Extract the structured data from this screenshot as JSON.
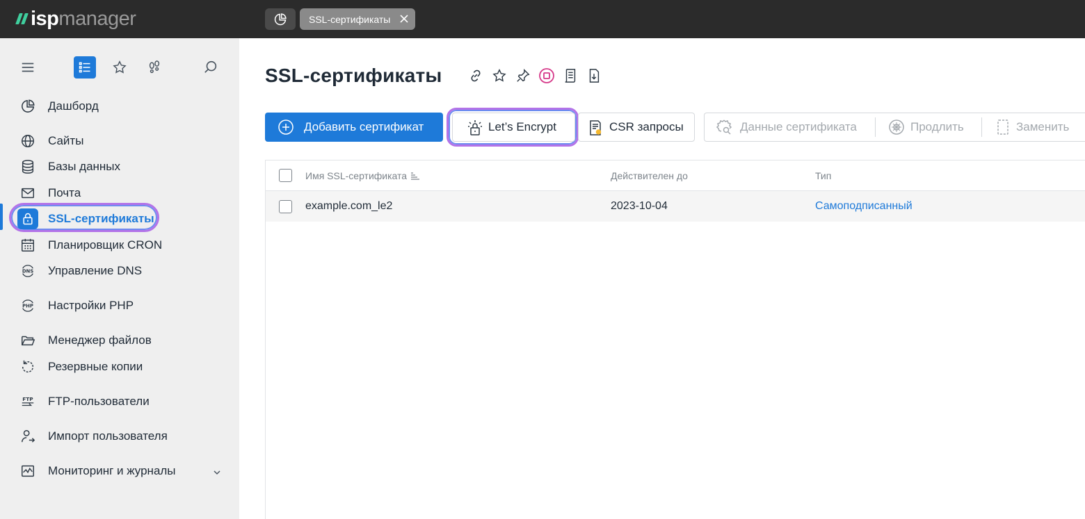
{
  "app": {
    "logo_isp": "isp",
    "logo_manager": "manager"
  },
  "tabs": [
    {
      "icon": "dashboard-pie-icon"
    },
    {
      "label": "SSL-сертификаты",
      "icon": "close-icon"
    }
  ],
  "sidebar": {
    "tools": [
      "menu-icon",
      "list-icon",
      "star-icon",
      "footprints-icon",
      "search-icon"
    ],
    "items": [
      {
        "label": "Дашборд",
        "icon": "dashboard-pie-icon"
      },
      {
        "label": "Сайты",
        "icon": "globe-icon"
      },
      {
        "label": "Базы данных",
        "icon": "database-icon"
      },
      {
        "label": "Почта",
        "icon": "mail-icon"
      },
      {
        "label": "SSL-сертификаты",
        "icon": "lock-icon",
        "active": true
      },
      {
        "label": "Планировщик CRON",
        "icon": "calendar-icon"
      },
      {
        "label": "Управление DNS",
        "icon": "dns-icon"
      },
      {
        "label": "Настройки PHP",
        "icon": "php-icon"
      },
      {
        "label": "Менеджер файлов",
        "icon": "folder-icon"
      },
      {
        "label": "Резервные копии",
        "icon": "backup-icon"
      },
      {
        "label": "FTP-пользователи",
        "icon": "ftp-icon"
      },
      {
        "label": "Импорт пользователя",
        "icon": "user-import-icon"
      },
      {
        "label": "Мониторинг и журналы",
        "icon": "monitoring-icon"
      }
    ]
  },
  "page": {
    "title": "SSL-сертификаты",
    "title_icons": [
      "link-icon",
      "star-icon",
      "pin-icon",
      "stop-icon",
      "log-icon",
      "download-icon"
    ]
  },
  "toolbar": {
    "add": "Добавить сертификат",
    "letsencrypt": "Let’s Encrypt",
    "csr": "CSR запросы",
    "details": "Данные сертификата",
    "renew": "Продлить",
    "replace": "Заменить"
  },
  "table": {
    "columns": [
      "Имя SSL-сертификата",
      "Действителен до",
      "Тип"
    ],
    "rows": [
      {
        "name": "example.com_le2",
        "valid_until": "2023-10-04",
        "type": "Самоподписанный"
      }
    ]
  },
  "colors": {
    "accent": "#1e7ad9",
    "highlight": "#b373e8",
    "topbar": "#2b2b2b",
    "sidebar": "#efefef",
    "logo_green": "#3fcf9e"
  }
}
